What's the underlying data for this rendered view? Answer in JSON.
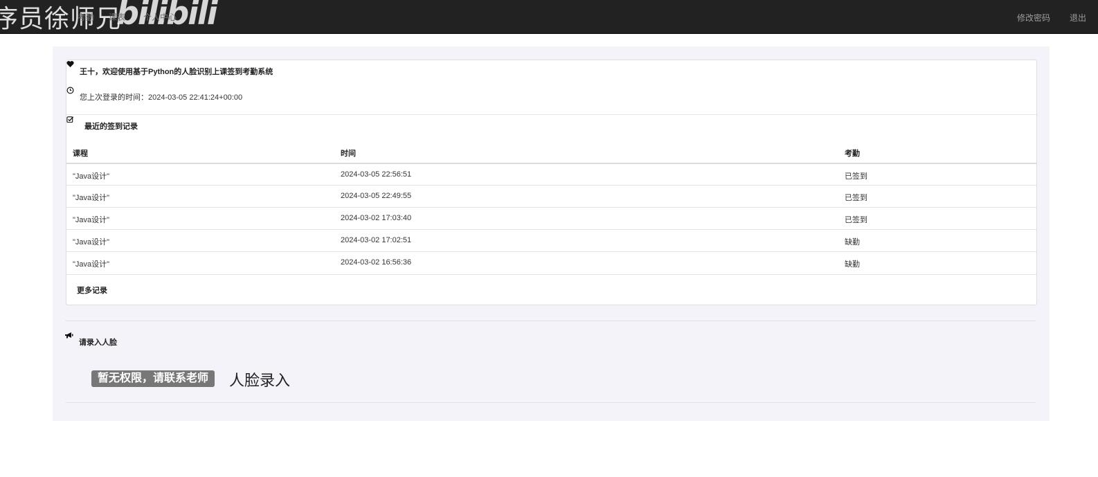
{
  "watermark": {
    "text": "序员徐师兄",
    "logo_text": "bilibili"
  },
  "navbar": {
    "faded_items": [
      "考勤",
      "课表",
      "个人中心"
    ],
    "change_password": "修改密码",
    "logout": "退出"
  },
  "dashboard": {
    "welcome": "王十，欢迎使用基于Python的人脸识别上课签到考勤系统",
    "last_login": "您上次登录的时间：2024-03-05 22:41:24+00:00",
    "records_title": "最近的签到记录",
    "columns": [
      "课程",
      "时间",
      "考勤"
    ],
    "rows": [
      [
        "\"Java设计\"",
        "2024-03-05 22:56:51",
        "已签到"
      ],
      [
        "\"Java设计\"",
        "2024-03-05 22:49:55",
        "已签到"
      ],
      [
        "\"Java设计\"",
        "2024-03-02 17:03:40",
        "已签到"
      ],
      [
        "\"Java设计\"",
        "2024-03-02 17:02:51",
        "缺勤"
      ],
      [
        "\"Java设计\"",
        "2024-03-02 16:56:36",
        "缺勤"
      ]
    ],
    "more": "更多记录"
  },
  "face": {
    "title": "请录入人脸",
    "badge": "暂无权限，请联系老师",
    "heading": "人脸录入"
  },
  "icons": {
    "welcome": "heart-icon",
    "last_login": "clock-icon",
    "records": "check-square-icon",
    "face": "bullhorn-icon"
  },
  "colors": {
    "navbar": "#222222",
    "container": "#f4f3fa",
    "badge": "#777777"
  }
}
